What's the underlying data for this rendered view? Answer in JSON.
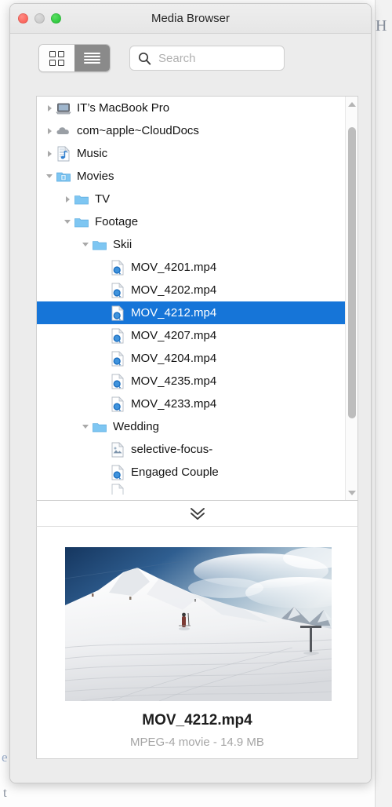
{
  "window": {
    "title": "Media Browser",
    "traffic_lights": [
      {
        "name": "close",
        "color": "#f9564c"
      },
      {
        "name": "minimize",
        "color": "#c4c4c4"
      },
      {
        "name": "maximize",
        "color": "#20c033"
      }
    ]
  },
  "toolbar": {
    "view_modes": [
      {
        "id": "grid",
        "icon": "grid-view-icon",
        "active": false
      },
      {
        "id": "list",
        "icon": "list-view-icon",
        "active": true
      }
    ],
    "search": {
      "icon": "search-icon",
      "placeholder": "Search",
      "value": ""
    }
  },
  "tree": {
    "rows": [
      {
        "label": "IT’s MacBook Pro",
        "indent": 0,
        "disclosure": "closed",
        "icon": "laptop-icon",
        "selected": false
      },
      {
        "label": "com~apple~CloudDocs",
        "indent": 0,
        "disclosure": "closed",
        "icon": "cloud-icon",
        "selected": false
      },
      {
        "label": "Music",
        "indent": 0,
        "disclosure": "closed",
        "icon": "music-doc-icon",
        "selected": false
      },
      {
        "label": "Movies",
        "indent": 0,
        "disclosure": "open",
        "icon": "movies-folder-icon",
        "selected": false
      },
      {
        "label": "TV",
        "indent": 1,
        "disclosure": "closed",
        "icon": "folder-icon",
        "selected": false
      },
      {
        "label": "Footage",
        "indent": 1,
        "disclosure": "open",
        "icon": "folder-icon",
        "selected": false
      },
      {
        "label": "Skii",
        "indent": 2,
        "disclosure": "open",
        "icon": "folder-icon",
        "selected": false
      },
      {
        "label": "MOV_4201.mp4",
        "indent": 3,
        "disclosure": "none",
        "icon": "quicktime-movie-icon",
        "selected": false
      },
      {
        "label": "MOV_4202.mp4",
        "indent": 3,
        "disclosure": "none",
        "icon": "quicktime-movie-icon",
        "selected": false
      },
      {
        "label": "MOV_4212.mp4",
        "indent": 3,
        "disclosure": "none",
        "icon": "quicktime-movie-icon",
        "selected": true
      },
      {
        "label": "MOV_4207.mp4",
        "indent": 3,
        "disclosure": "none",
        "icon": "quicktime-movie-icon",
        "selected": false
      },
      {
        "label": "MOV_4204.mp4",
        "indent": 3,
        "disclosure": "none",
        "icon": "quicktime-movie-icon",
        "selected": false
      },
      {
        "label": "MOV_4235.mp4",
        "indent": 3,
        "disclosure": "none",
        "icon": "quicktime-movie-icon",
        "selected": false
      },
      {
        "label": "MOV_4233.mp4",
        "indent": 3,
        "disclosure": "none",
        "icon": "quicktime-movie-icon",
        "selected": false
      },
      {
        "label": "Wedding",
        "indent": 2,
        "disclosure": "open",
        "icon": "folder-icon",
        "selected": false
      },
      {
        "label": "selective-focus-",
        "indent": 3,
        "disclosure": "none",
        "icon": "image-doc-icon",
        "selected": false
      },
      {
        "label": "Engaged Couple",
        "indent": 3,
        "disclosure": "none",
        "icon": "quicktime-movie-icon",
        "selected": false
      },
      {
        "label": "",
        "indent": 3,
        "disclosure": "none",
        "icon": "generic-doc-icon",
        "selected": false,
        "clipped": true
      }
    ],
    "selection_color": "#1675d8",
    "scrollbar": {
      "orientation": "vertical",
      "thumb_top_pct": 4,
      "thumb_height_pct": 78
    }
  },
  "collapse_bar": {
    "icon": "double-chevron-down-icon"
  },
  "preview": {
    "thumbnail_alt": "snow-covered ski slope with skier and chairlift pole",
    "name": "MOV_4212.mp4",
    "meta": "MPEG-4 movie - 14.9 MB"
  },
  "background": {
    "glyph_top_right": "H",
    "glyph_left_mid": "e",
    "glyph_left_low": "t"
  }
}
